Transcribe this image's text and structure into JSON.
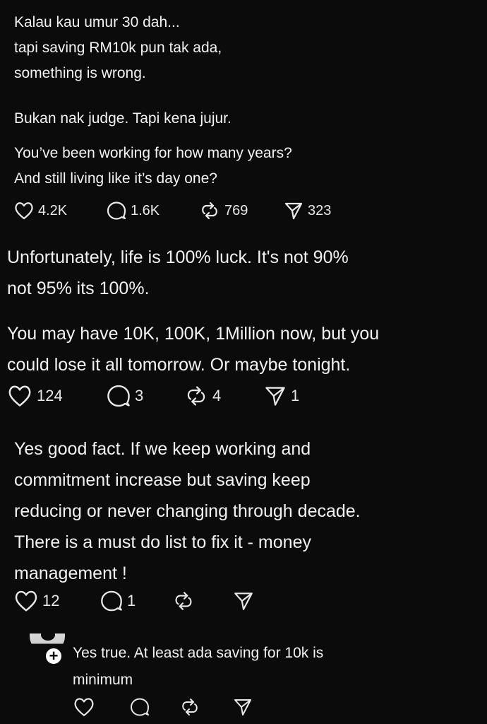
{
  "post": {
    "paragraph1": "Kalau kau umur 30 dah...\ntapi saving RM10k pun tak ada,\nsomething is wrong.",
    "paragraph2": "Bukan nak judge. Tapi kena jujur.",
    "paragraph3": "You’ve been working for how many years?\nAnd still living like it’s day one?",
    "actions": {
      "likes": "4.2K",
      "comments": "1.6K",
      "reposts": "769",
      "shares": "323"
    }
  },
  "reply1": {
    "paragraph1": "Unfortunately, life is 100% luck. It's not 90%\nnot 95% its 100%.",
    "paragraph2": "You may have 10K, 100K, 1Million now, but you\ncould lose it all tomorrow. Or maybe tonight.",
    "actions": {
      "likes": "124",
      "comments": "3",
      "reposts": "4",
      "shares": "1"
    }
  },
  "reply2": {
    "text": "Yes good fact. If we keep working and\ncommitment increase but saving keep\nreducing or never changing through decade.\nThere is a must do list to fix it - money\nmanagement !",
    "actions": {
      "likes": "12",
      "comments": "1"
    }
  },
  "reply3": {
    "follow_symbol": "+",
    "text": "Yes true. At least ada saving for 10k is\nminimum"
  },
  "icons": {
    "like": "heart-icon",
    "comment": "comment-bubble-icon",
    "repost": "repost-icon",
    "share": "share-send-icon",
    "follow": "plus-icon"
  },
  "colors": {
    "background": "#0b0b0c",
    "text": "#f2f2f2"
  }
}
